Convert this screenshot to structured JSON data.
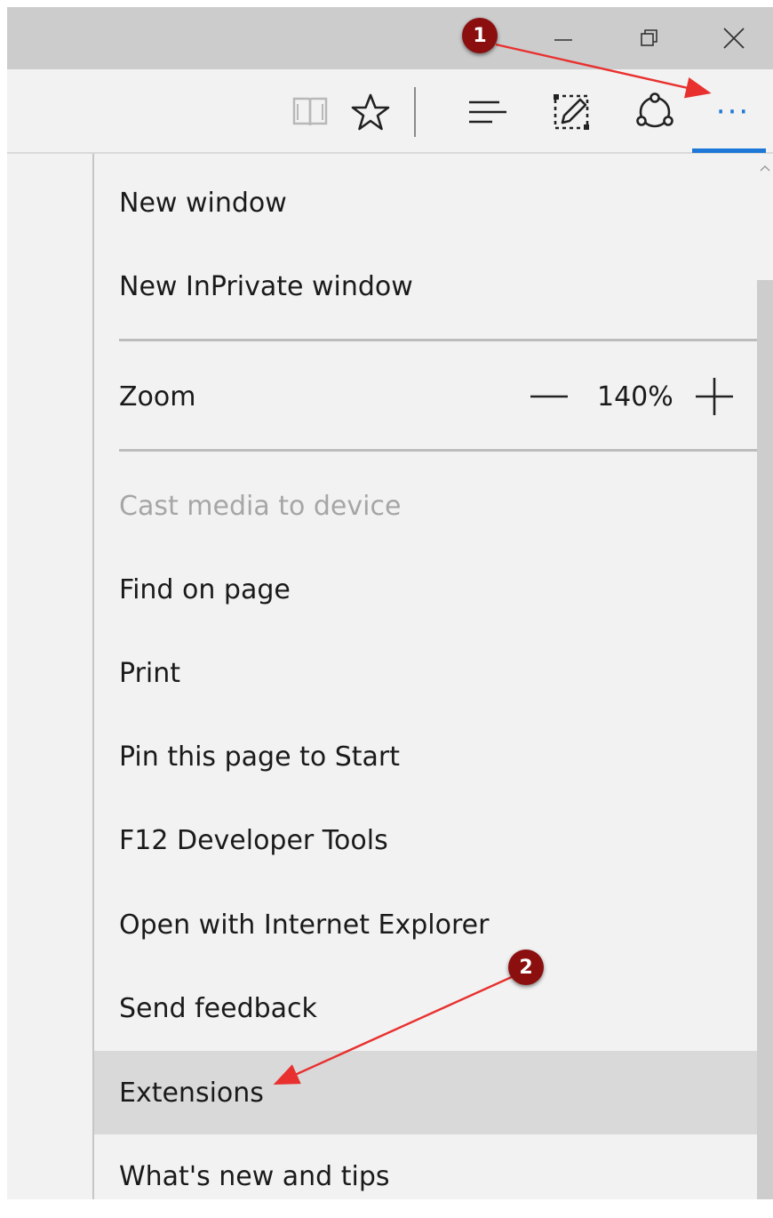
{
  "window_controls": {
    "minimize": "minimize-icon",
    "restore": "restore-icon",
    "close": "close-icon"
  },
  "toolbar": {
    "icons": [
      "reading-view-icon",
      "favorites-star-icon",
      "hub-icon",
      "web-note-icon",
      "share-icon",
      "more-actions-icon"
    ],
    "more_label": "···"
  },
  "menu": {
    "new_window": "New window",
    "new_inprivate_window": "New InPrivate window",
    "zoom_label": "Zoom",
    "zoom_value": "140%",
    "cast_media": "Cast media to device",
    "find_on_page": "Find on page",
    "print": "Print",
    "pin_to_start": "Pin this page to Start",
    "dev_tools": "F12 Developer Tools",
    "open_with_ie": "Open with Internet Explorer",
    "send_feedback": "Send feedback",
    "extensions": "Extensions",
    "whats_new": "What's new and tips"
  },
  "annotations": {
    "badge_1": "1",
    "badge_2": "2",
    "badge_color": "#8b0f0f",
    "arrow_color": "#e8312f"
  },
  "colors": {
    "accent": "#1e78d7",
    "highlight": "#d9d9d9"
  }
}
